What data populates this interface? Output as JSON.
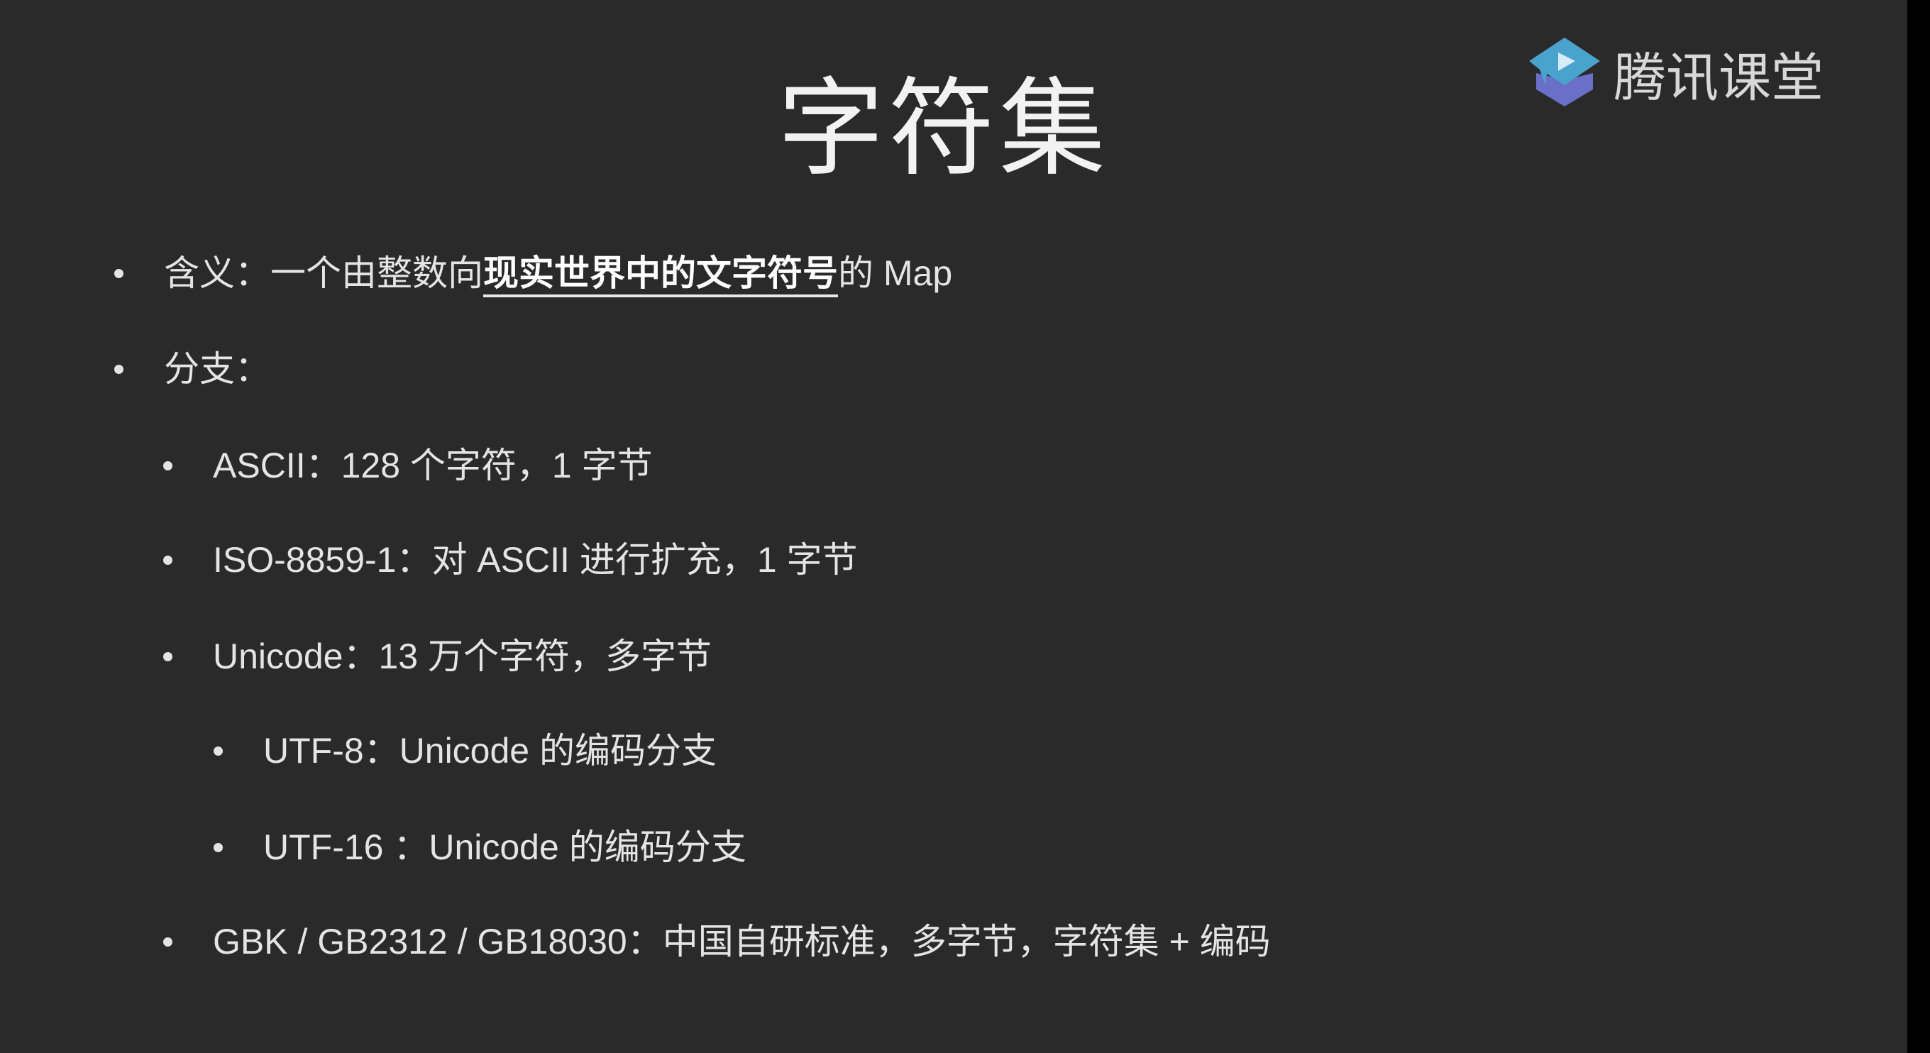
{
  "slide": {
    "title": "字符集",
    "logo": {
      "text": "腾讯课堂",
      "icon": "tencent-classroom-logo-icon",
      "colors": {
        "primary": "#4aa3cc",
        "secondary": "#6a6fc8"
      }
    },
    "bullets": [
      {
        "level": 1,
        "prefix": "含义：一个由整数向",
        "highlight": "现实世界中的文字符号",
        "suffix": "的 Map"
      },
      {
        "level": 1,
        "text": "分支："
      },
      {
        "level": 2,
        "text": "ASCII：128 个字符，1 字节"
      },
      {
        "level": 2,
        "text": "ISO-8859-1：对 ASCII 进行扩充，1 字节"
      },
      {
        "level": 2,
        "text": "Unicode：13 万个字符，多字节"
      },
      {
        "level": 3,
        "text": "UTF-8：Unicode 的编码分支"
      },
      {
        "level": 3,
        "text": "UTF-16 ：Unicode 的编码分支"
      },
      {
        "level": 2,
        "text": "GBK / GB2312 / GB18030：中国自研标准，多字节，字符集 + 编码"
      }
    ]
  }
}
